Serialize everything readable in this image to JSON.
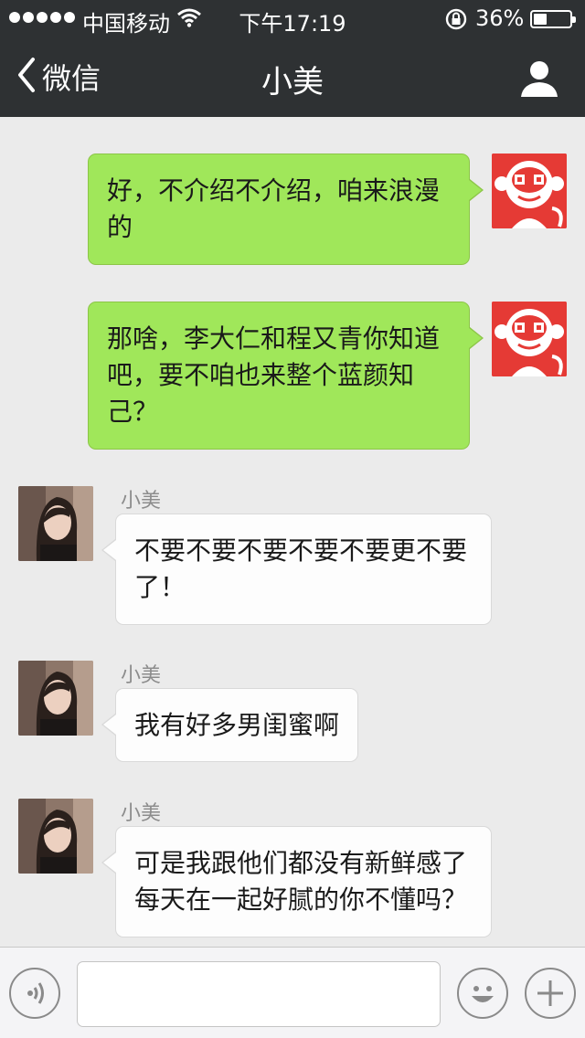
{
  "status_bar": {
    "carrier": "中国移动",
    "time": "下午17:19",
    "battery_percent_label": "36%",
    "battery_level": 0.36,
    "icons": [
      "signal-dots-icon",
      "wifi-icon",
      "rotation-lock-icon",
      "battery-icon"
    ]
  },
  "nav": {
    "back_label": "微信",
    "title": "小美",
    "icons": [
      "back-chevron-icon",
      "profile-icon"
    ]
  },
  "messages": [
    {
      "direction": "outgoing",
      "text": "好，不介绍不介绍，咱来浪漫的"
    },
    {
      "direction": "outgoing",
      "text": "那啥，李大仁和程又青你知道吧，要不咱也来整个蓝颜知己？"
    },
    {
      "direction": "incoming",
      "sender": "小美",
      "text": "不要不要不要不要不要更不要了！"
    },
    {
      "direction": "incoming",
      "sender": "小美",
      "text": "我有好多男闺蜜啊"
    },
    {
      "direction": "incoming",
      "sender": "小美",
      "text": "可是我跟他们都没有新鲜感了每天在一起好腻的你不懂吗？"
    }
  ],
  "input_bar": {
    "value": "",
    "icons": [
      "voice-icon",
      "emoji-icon",
      "plus-icon"
    ]
  },
  "colors": {
    "nav_bg": "#2e3133",
    "chat_bg": "#ebebeb",
    "outgoing_bubble": "#a0e75a",
    "incoming_bubble": "#fdfdfd",
    "my_avatar_bg": "#e53a35"
  }
}
